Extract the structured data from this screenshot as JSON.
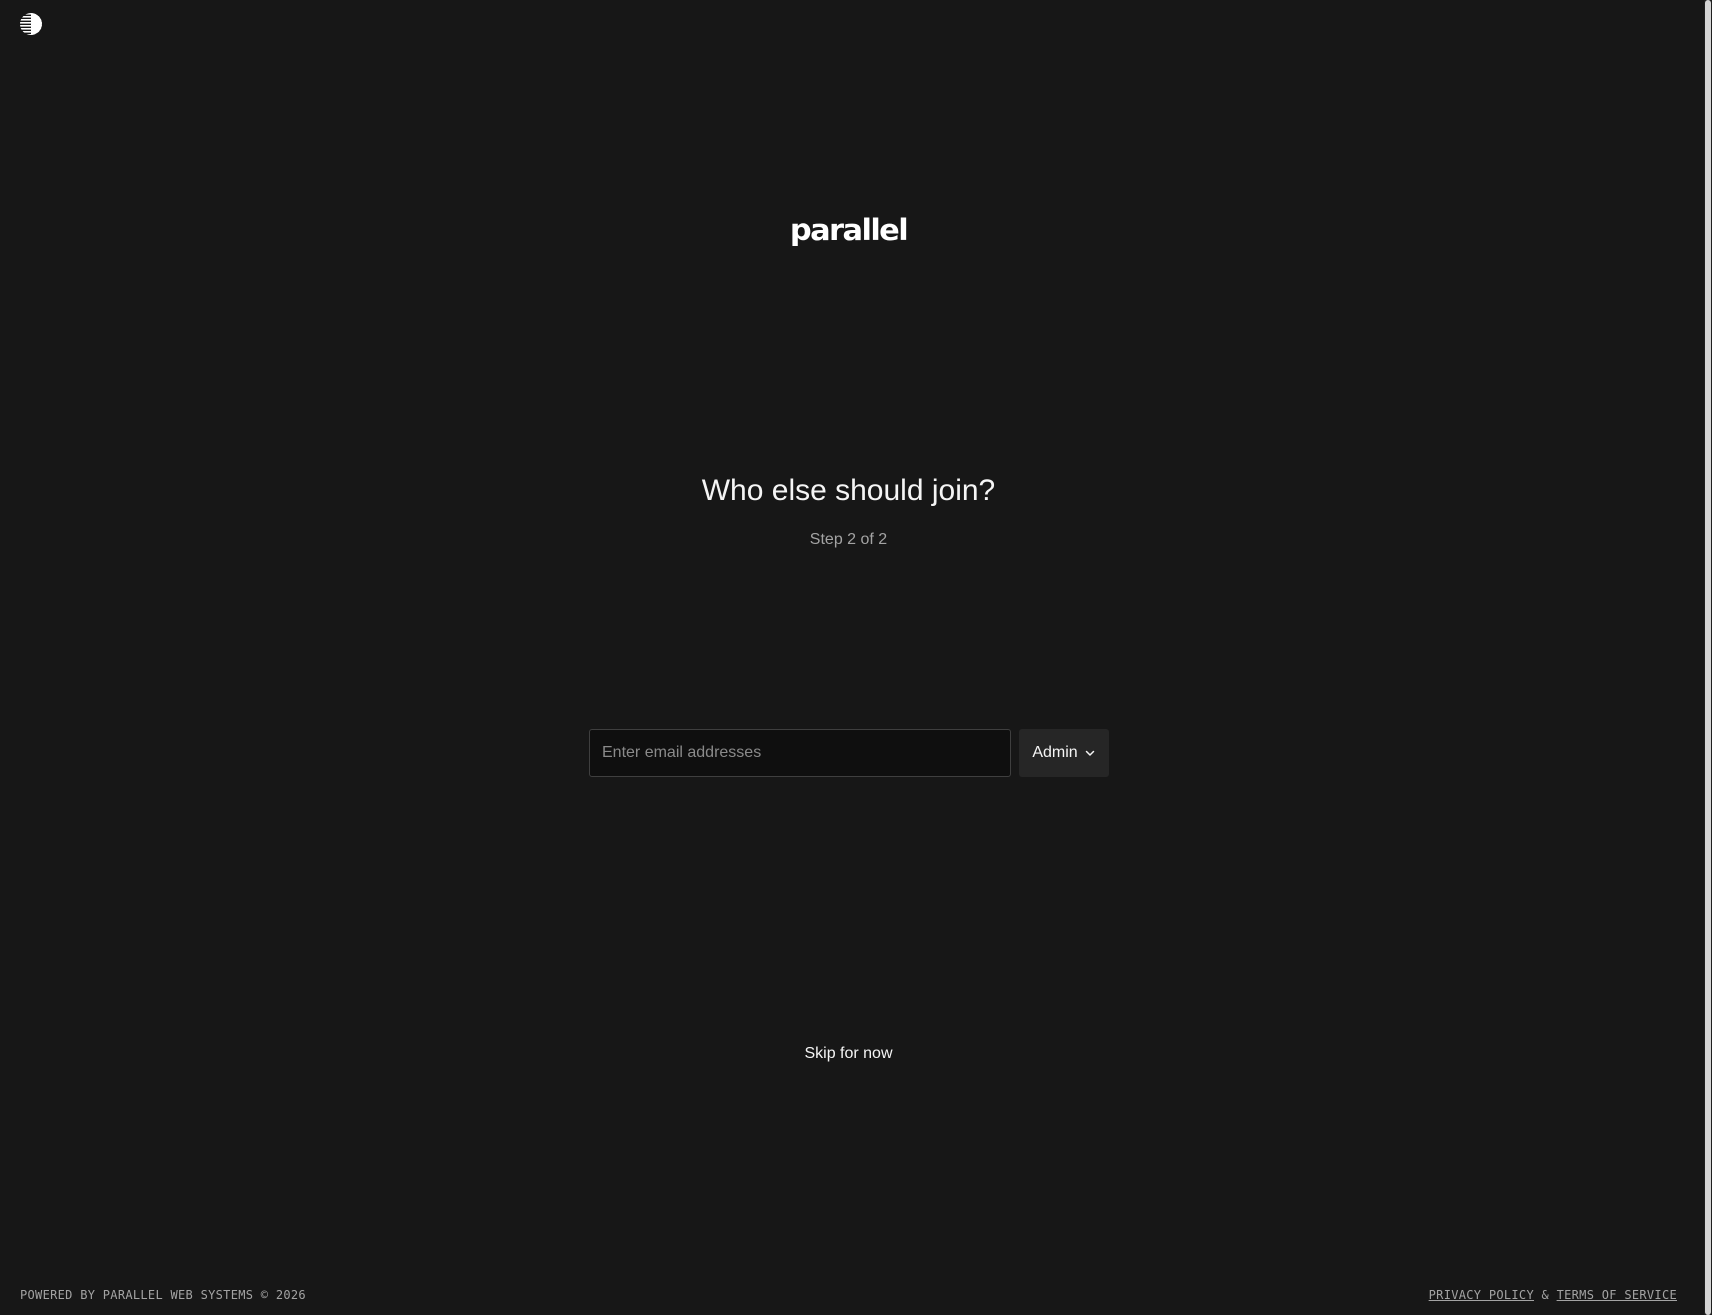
{
  "brand": {
    "logo_icon": "parallel-globe-icon",
    "wordmark": "parallel"
  },
  "onboarding": {
    "heading": "Who else should join?",
    "step": "Step 2 of 2",
    "email_placeholder": "Enter email addresses",
    "email_value": "",
    "role_selected": "Admin",
    "role_icon": "chevron-down-icon",
    "skip_label": "Skip for now"
  },
  "footer": {
    "powered_by": "POWERED BY PARALLEL WEB SYSTEMS © 2026",
    "privacy_label": "PRIVACY POLICY",
    "separator": "&",
    "terms_label": "TERMS OF SERVICE"
  },
  "colors": {
    "background": "#171717",
    "input_bg": "#0f0f0f",
    "select_bg": "#262626",
    "text": "#f5f5f5",
    "muted": "#a3a3a3"
  }
}
